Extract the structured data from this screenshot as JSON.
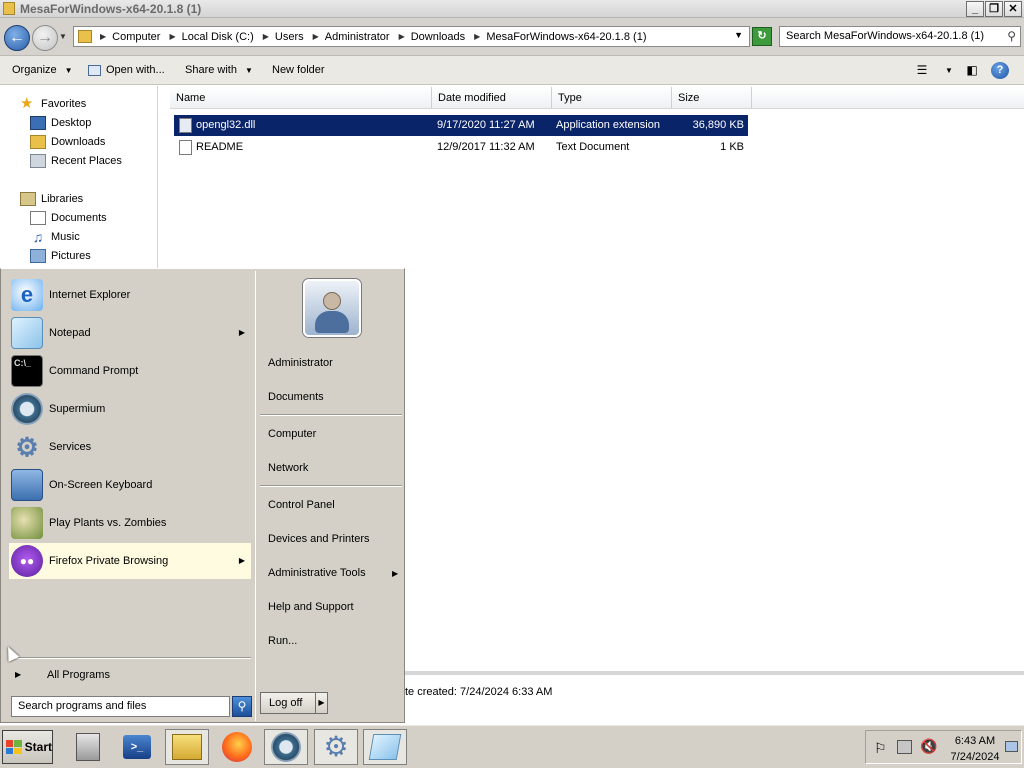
{
  "window": {
    "title": "MesaForWindows-x64-20.1.8 (1)",
    "controls": {
      "minimize": "_",
      "restore": "❐",
      "close": "✕"
    }
  },
  "address": {
    "breadcrumbs": [
      "Computer",
      "Local Disk (C:)",
      "Users",
      "Administrator",
      "Downloads",
      "MesaForWindows-x64-20.1.8 (1)"
    ],
    "search_placeholder": "Search MesaForWindows-x64-20.1.8 (1)"
  },
  "toolbar": {
    "organize": "Organize",
    "open_with": "Open with...",
    "share_with": "Share with",
    "new_folder": "New folder"
  },
  "navpane": {
    "favorites": "Favorites",
    "desktop": "Desktop",
    "downloads": "Downloads",
    "recent_places": "Recent Places",
    "libraries": "Libraries",
    "documents": "Documents",
    "music": "Music",
    "pictures": "Pictures"
  },
  "columns": {
    "name": "Name",
    "date_modified": "Date modified",
    "type": "Type",
    "size": "Size"
  },
  "files": [
    {
      "name": "opengl32.dll",
      "date": "9/17/2020 11:27 AM",
      "type": "Application extension",
      "size": "36,890 KB"
    },
    {
      "name": "README",
      "date": "12/9/2017 11:32 AM",
      "type": "Text Document",
      "size": "1 KB"
    }
  ],
  "details": {
    "date_created": "te created:  7/24/2024 6:33 AM"
  },
  "startmenu": {
    "programs": [
      {
        "label": "Internet Explorer"
      },
      {
        "label": "Notepad"
      },
      {
        "label": "Command Prompt"
      },
      {
        "label": "Supermium"
      },
      {
        "label": "Services"
      },
      {
        "label": "On-Screen Keyboard"
      },
      {
        "label": "Play Plants vs. Zombies"
      },
      {
        "label": "Firefox Private Browsing"
      }
    ],
    "all_programs": "All Programs",
    "search_placeholder": "Search programs and files",
    "places": {
      "user": "Administrator",
      "documents": "Documents",
      "computer": "Computer",
      "network": "Network",
      "control_panel": "Control Panel",
      "devices_printers": "Devices and Printers",
      "admin_tools": "Administrative Tools",
      "help_support": "Help and Support",
      "run": "Run..."
    },
    "log_off": "Log off"
  },
  "taskbar": {
    "start": "Start",
    "time": "6:43 AM",
    "date": "7/24/2024"
  }
}
